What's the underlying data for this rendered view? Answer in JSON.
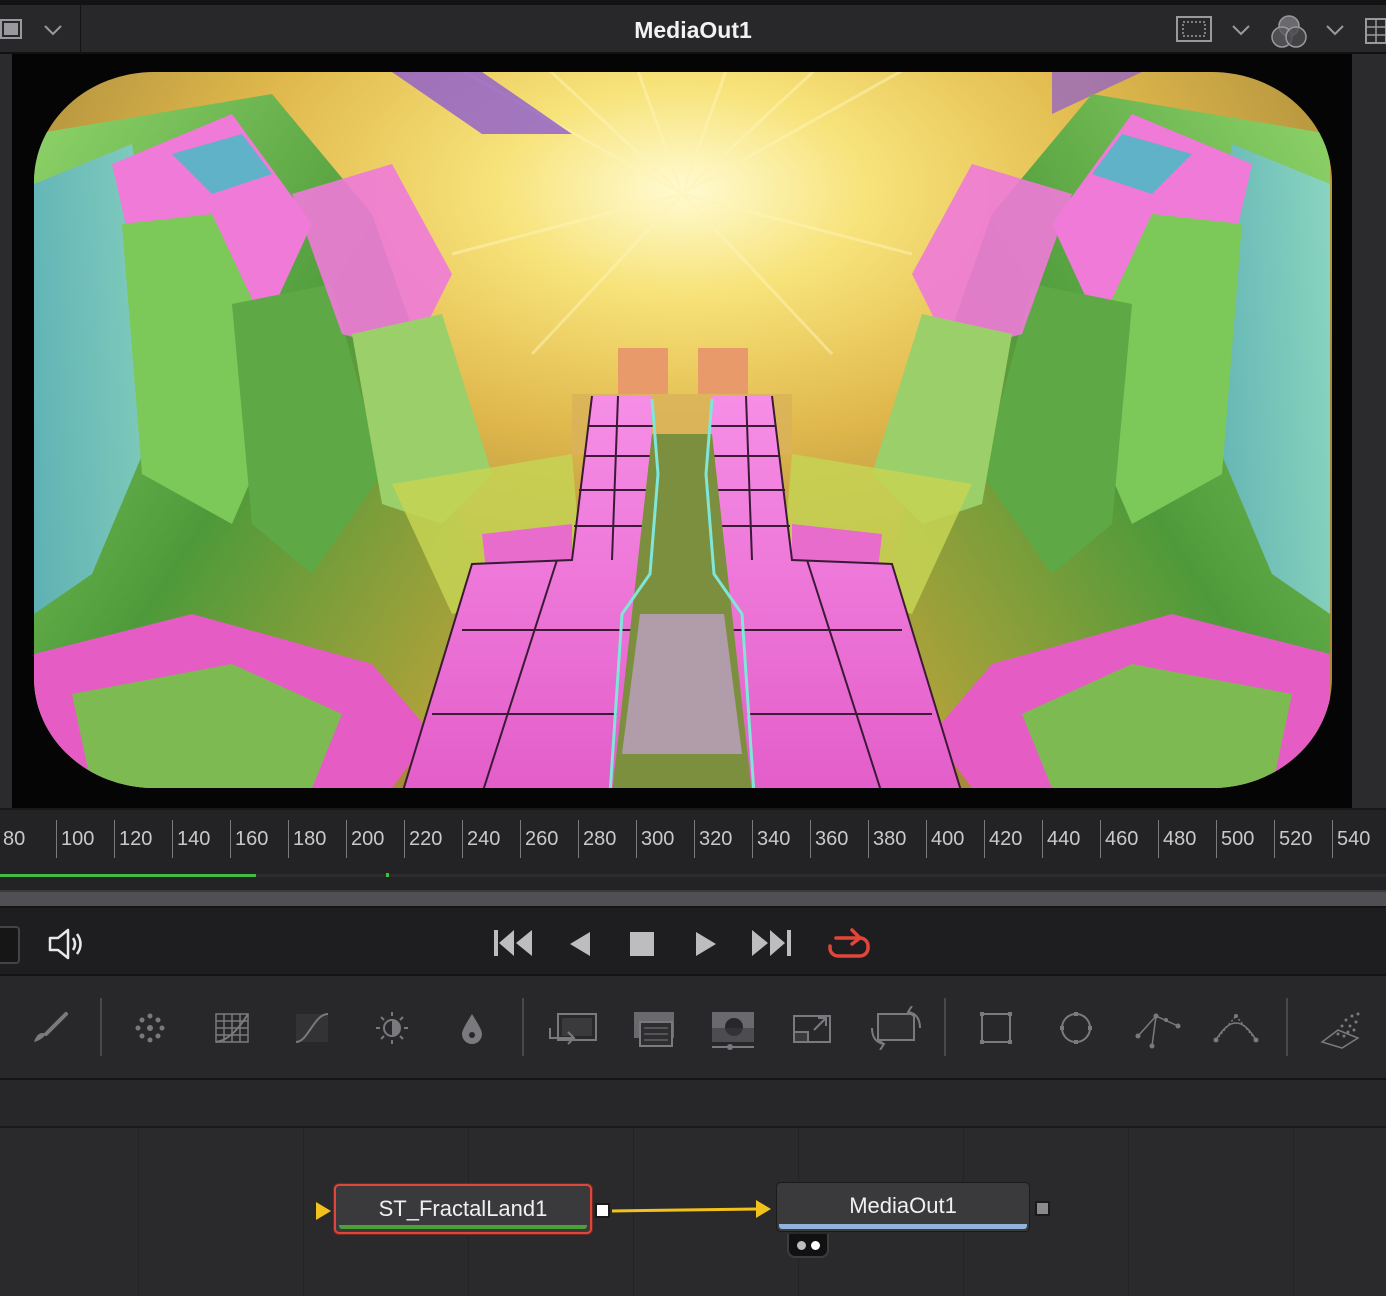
{
  "viewer": {
    "title": "MediaOut1",
    "icons": [
      "viewer-layout-icon",
      "chevron-down-icon",
      "roi-icon",
      "chevron-down-icon",
      "color-channels-icon",
      "chevron-down-icon",
      "grid-icon"
    ]
  },
  "timeline": {
    "ticks": [
      "80",
      "100",
      "120",
      "140",
      "160",
      "180",
      "200",
      "220",
      "240",
      "260",
      "280",
      "300",
      "320",
      "340",
      "360",
      "380",
      "400",
      "420",
      "440",
      "460",
      "480",
      "500",
      "520",
      "540"
    ],
    "render_progress_fraction": 0.185
  },
  "transport": {
    "buttons": [
      "audio-icon",
      "go-to-start-icon",
      "play-reverse-icon",
      "stop-icon",
      "play-forward-icon",
      "go-to-end-icon",
      "loop-icon"
    ],
    "loop_color": "#e0463a"
  },
  "toolbar": {
    "tools": [
      "paint-tool",
      "particle-emitter-tool",
      "grid-warp-tool",
      "color-curves-tool",
      "brightness-contrast-tool",
      "blur-tool",
      "merge-tool",
      "background-tool",
      "text-matte-tool",
      "resize-tool",
      "transform-tool",
      "rectangle-mask-tool",
      "ellipse-mask-tool",
      "polygon-mask-tool",
      "bspline-mask-tool",
      "particle-render-tool"
    ]
  },
  "nodes": {
    "source": {
      "label": "ST_FractalLand1",
      "accent": "#4da036",
      "selected_border": "#e0463a"
    },
    "output": {
      "label": "MediaOut1",
      "accent": "#8fb3d9"
    }
  }
}
